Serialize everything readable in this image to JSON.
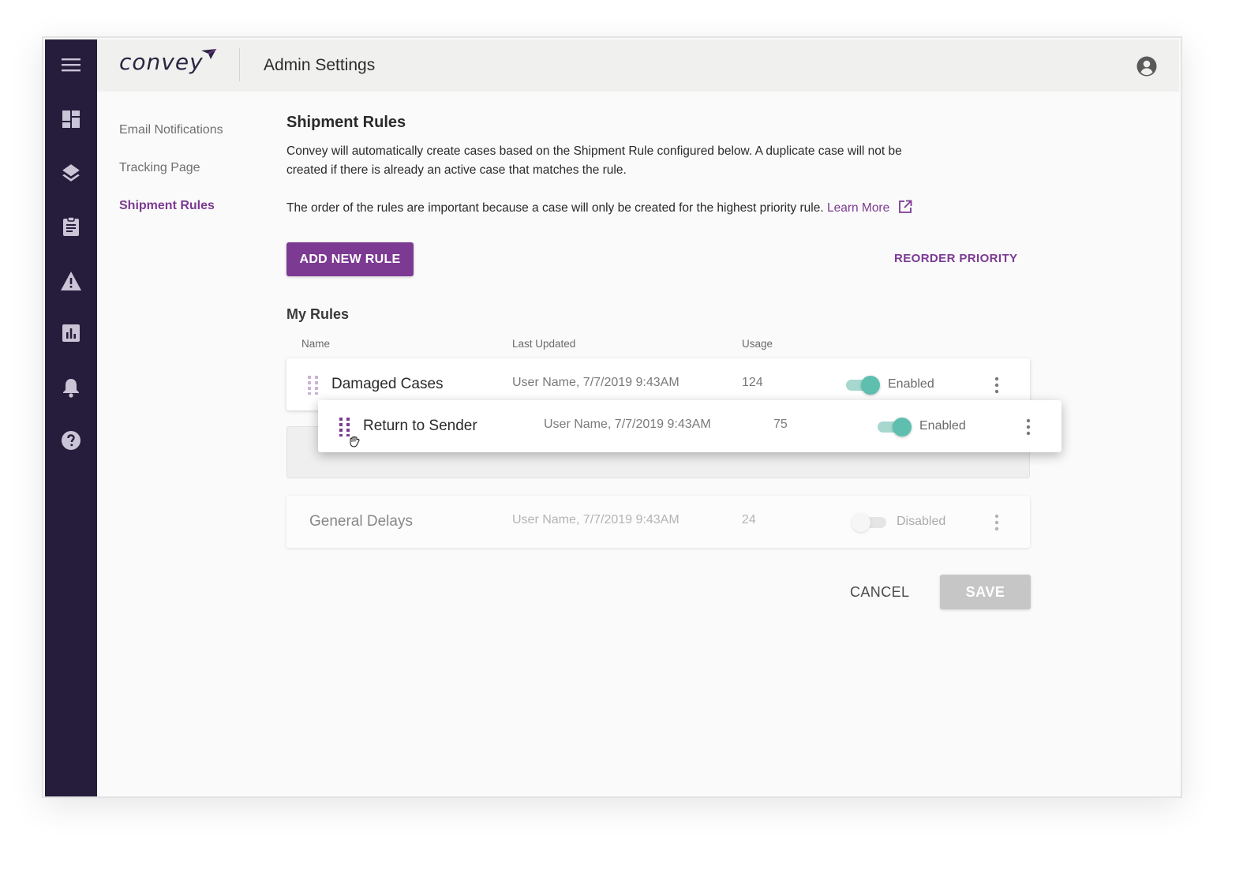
{
  "app": {
    "logo_text": "convey",
    "page_title": "Admin Settings",
    "accent_color": "#7c3a93",
    "sidebar_color": "#261c3b"
  },
  "sidebar": {
    "icons": [
      "menu-icon",
      "dashboard-icon",
      "layers-icon",
      "clipboard-icon",
      "warning-icon",
      "bar-chart-icon",
      "bell-icon",
      "help-icon"
    ]
  },
  "subnav": {
    "items": [
      {
        "label": "Email Notifications",
        "active": false
      },
      {
        "label": "Tracking Page",
        "active": false
      },
      {
        "label": "Shipment Rules",
        "active": true
      }
    ]
  },
  "main": {
    "heading": "Shipment Rules",
    "description": "Convey will automatically create cases based on the Shipment Rule configured below. A duplicate case will not be created if there is already an active case that matches the rule.",
    "order_note": "The order of the rules are important because a case will only be created for the highest priority rule.",
    "learn_more": "Learn More",
    "add_button": "ADD NEW RULE",
    "reorder_button": "REORDER PRIORITY",
    "rules_heading": "My Rules",
    "columns": {
      "name": "Name",
      "last_updated": "Last Updated",
      "usage": "Usage"
    },
    "rules": [
      {
        "name": "Damaged Cases",
        "last_updated": "User Name, 7/7/2019 9:43AM",
        "usage": "124",
        "status": "Enabled",
        "enabled": true
      },
      {
        "name": "Return to Sender",
        "last_updated": "User Name, 7/7/2019 9:43AM",
        "usage": "75",
        "status": "Enabled",
        "enabled": true,
        "dragging": true
      },
      {
        "name": "General Delays",
        "last_updated": "User Name, 7/7/2019 9:43AM",
        "usage": "24",
        "status": "Disabled",
        "enabled": false
      }
    ],
    "cancel_button": "CANCEL",
    "save_button": "SAVE"
  }
}
